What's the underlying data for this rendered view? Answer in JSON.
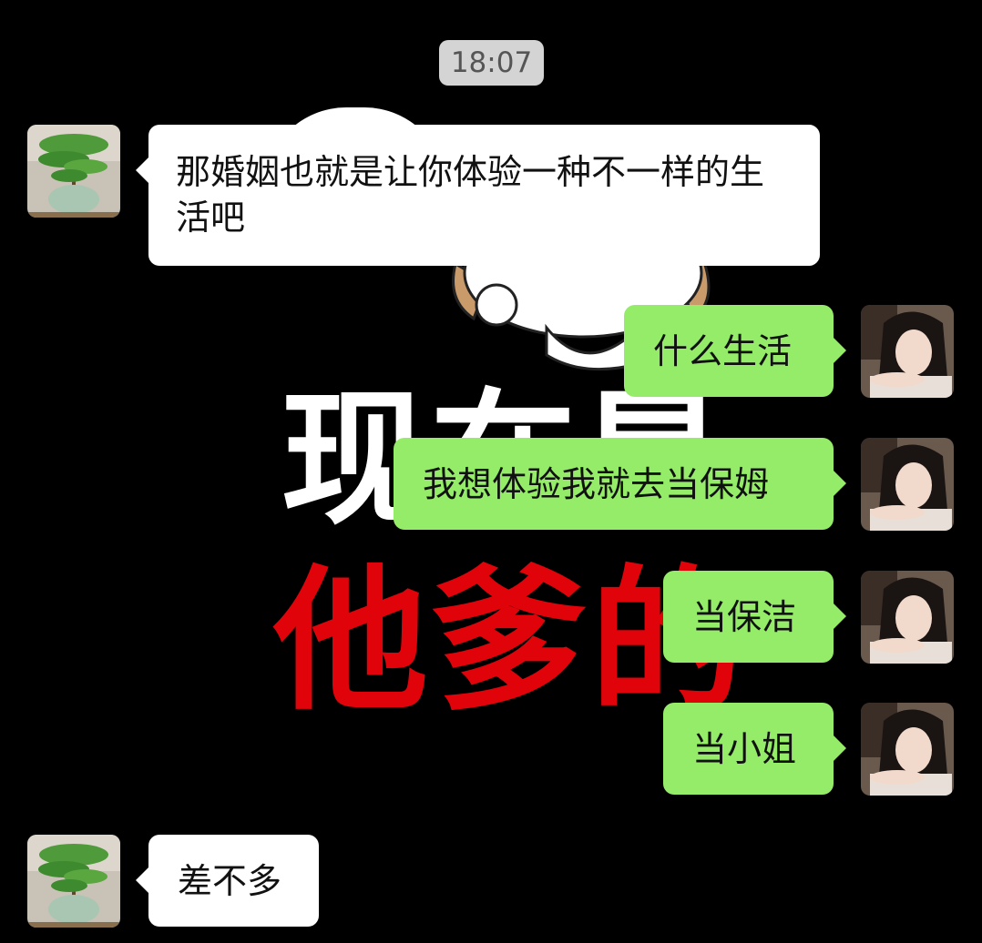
{
  "chat": {
    "timestamp": "18:07",
    "messages": [
      {
        "side": "left",
        "avatar": "plant-avatar",
        "text": "那婚姻也就是让你体验一种不一样的生活吧"
      },
      {
        "side": "right",
        "avatar": "girl-avatar",
        "text": "什么生活"
      },
      {
        "side": "right",
        "avatar": "girl-avatar",
        "text": "我想体验我就去当保姆"
      },
      {
        "side": "right",
        "avatar": "girl-avatar",
        "text": "当保洁"
      },
      {
        "side": "right",
        "avatar": "girl-avatar",
        "text": "当小姐"
      },
      {
        "side": "left",
        "avatar": "plant-avatar",
        "text": "差不多"
      }
    ]
  },
  "background": {
    "meme_line1": "现在是",
    "meme_line2": "他爹的",
    "colors": {
      "white_text": "#ffffff",
      "red_text": "#e0040a",
      "bg": "#000000"
    }
  },
  "colors": {
    "left_bubble": "#ffffff",
    "right_bubble": "#95ec69",
    "timestamp_bg": "#d4d4d4"
  }
}
